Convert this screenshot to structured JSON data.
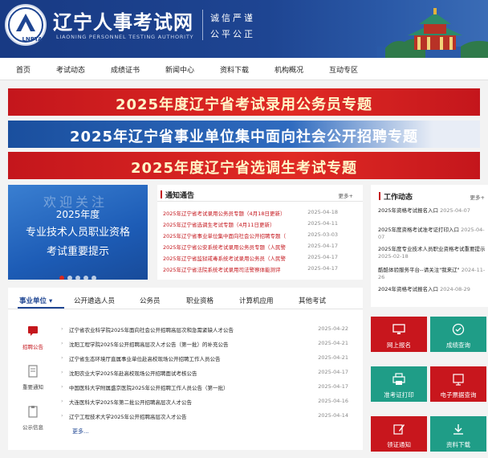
{
  "header": {
    "logo_text": "LNPTA",
    "title": "辽宁人事考试网",
    "subtitle": "LIAONING PERSONNEL TESTING AUTHORITY",
    "slogan_line1": "诚信严谨",
    "slogan_line2": "公平公正"
  },
  "nav": {
    "items": [
      {
        "label": "首页"
      },
      {
        "label": "考试动态"
      },
      {
        "label": "成绩证书"
      },
      {
        "label": "新闻中心"
      },
      {
        "label": "资料下载"
      },
      {
        "label": "机构概况"
      },
      {
        "label": "互动专区"
      }
    ]
  },
  "banners": [
    {
      "label": "2025年度辽宁省考试录用公务员专题"
    },
    {
      "label": "2025年辽宁省事业单位集中面向社会公开招聘专题"
    },
    {
      "label": "2025年度辽宁省选调生考试专题"
    }
  ],
  "slide": {
    "ghost": "欢迎关注",
    "line1": "2025年度",
    "line2": "专业技术人员职业资格",
    "line3": "考试重要提示"
  },
  "notice": {
    "title": "通知通告",
    "more": "更多+",
    "items": [
      {
        "title": "2025年辽宁省考试录用公务员专题（4月18日更新）",
        "date": "2025-04-18"
      },
      {
        "title": "2025年辽宁省选调生考试专题（4月11日更新）",
        "date": "2025-04-11"
      },
      {
        "title": "2025年辽宁省事业单位集中面向社会公开招聘专题（",
        "date": "2025-03-03"
      },
      {
        "title": "2025年辽宁省公安系统考试录用公务员专题（人民警",
        "date": "2025-04-17"
      },
      {
        "title": "2025年辽宁省监狱戒毒系统考试录用公务员（人民警",
        "date": "2025-04-17"
      },
      {
        "title": "2025年辽宁省法院系统考试录用司法警察体能测评",
        "date": "2025-04-17"
      }
    ]
  },
  "work": {
    "title": "工作动态",
    "more": "更多+",
    "items": [
      {
        "title": "2025年资格考试报名入口",
        "date": "2025-04-07"
      },
      {
        "title": "2025年度资格考试准考证打印入口",
        "date": "2025-04-07"
      },
      {
        "title": "2025年度专业技术人员职业资格考试重要提示",
        "date": "2025-02-18"
      },
      {
        "title": "酷酷体验服务平台--请关注\"我来辽\"",
        "date": "2024-11-26"
      },
      {
        "title": "2024年资格考试报名入口",
        "date": "2024-08-29"
      }
    ]
  },
  "tabs": {
    "items": [
      {
        "label": "事业单位"
      },
      {
        "label": "公开遴选人员"
      },
      {
        "label": "公务员"
      },
      {
        "label": "职业资格"
      },
      {
        "label": "计算机应用"
      },
      {
        "label": "其他考试"
      }
    ],
    "side": [
      {
        "label": "招聘公告"
      },
      {
        "label": "重要通知"
      },
      {
        "label": "公示信息"
      }
    ],
    "rows": [
      {
        "title": "辽宁省农业科学院2025年面向社会公开招聘高层次和急需紧缺人才公告",
        "date": "2025-04-22"
      },
      {
        "title": "沈阳工程学院2025年公开招聘高层次人才公告（第一批）的补充公告",
        "date": "2025-04-21"
      },
      {
        "title": "辽宁省生态环境厅直属事业单位赴高校现场公开招聘工作人员公告",
        "date": "2025-04-21"
      },
      {
        "title": "沈阳农业大学2025年赴高校现场公开招聘面试考核公告",
        "date": "2025-04-17"
      },
      {
        "title": "中国医科大学附属盛京医院2025年公开招聘工作人员公告（第一批）",
        "date": "2025-04-17"
      },
      {
        "title": "大连医科大学2025年第二批公开招聘高层次人才公告",
        "date": "2025-04-16"
      },
      {
        "title": "辽宁工程技术大学2025年公开招聘高层次人才公告",
        "date": "2025-04-14"
      }
    ],
    "more": "更多..."
  },
  "tiles": [
    {
      "label": "网上报名"
    },
    {
      "label": "成绩查询"
    },
    {
      "label": "准考证打印"
    },
    {
      "label": "电子票据查询"
    },
    {
      "label": "领证通知"
    },
    {
      "label": "资料下载"
    }
  ],
  "colors": {
    "brand_blue": "#1e4592",
    "brand_red": "#c4161c",
    "tile_green": "#1f9d87"
  }
}
